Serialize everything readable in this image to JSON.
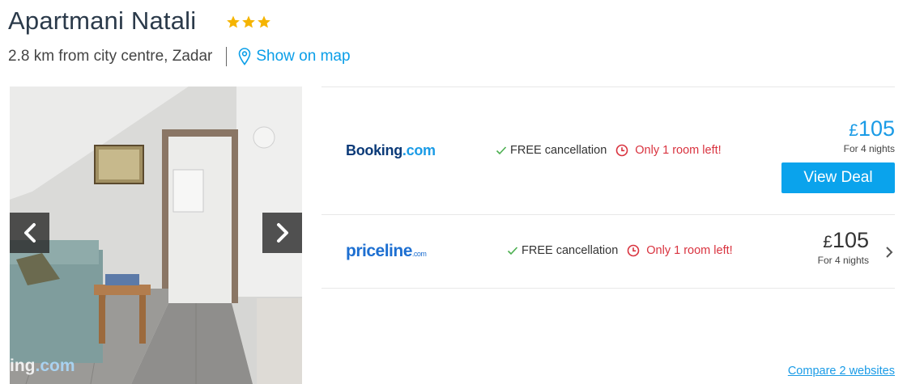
{
  "hotel": {
    "name": "Apartmani Natali",
    "star_rating": 3,
    "distance": "2.8 km from city centre, Zadar",
    "map_link": "Show on map"
  },
  "photo": {
    "watermark_prefix": "ing",
    "watermark_suffix": ".com",
    "prev_icon": "chevron-left-icon",
    "next_icon": "chevron-right-icon"
  },
  "deals": [
    {
      "provider": "Booking.com",
      "logo_main": "Booking",
      "logo_suffix": ".com",
      "free_cancel": "FREE cancellation",
      "rooms_left": "Only 1 room left!",
      "currency": "£",
      "price": "105",
      "nights": "For 4 nights",
      "button": "View Deal"
    },
    {
      "provider": "priceline.com",
      "logo_main": "priceline",
      "logo_suffix": ".com",
      "free_cancel": "FREE cancellation",
      "rooms_left": "Only 1 room left!",
      "currency": "£",
      "price": "105",
      "nights": "For 4 nights"
    }
  ],
  "compare_link": "Compare 2 websites",
  "colors": {
    "accent": "#0aa3ec",
    "link": "#1a9be6",
    "star": "#f5b400",
    "warning": "#d9333f",
    "check": "#4caf50",
    "title": "#2b3a4a"
  }
}
